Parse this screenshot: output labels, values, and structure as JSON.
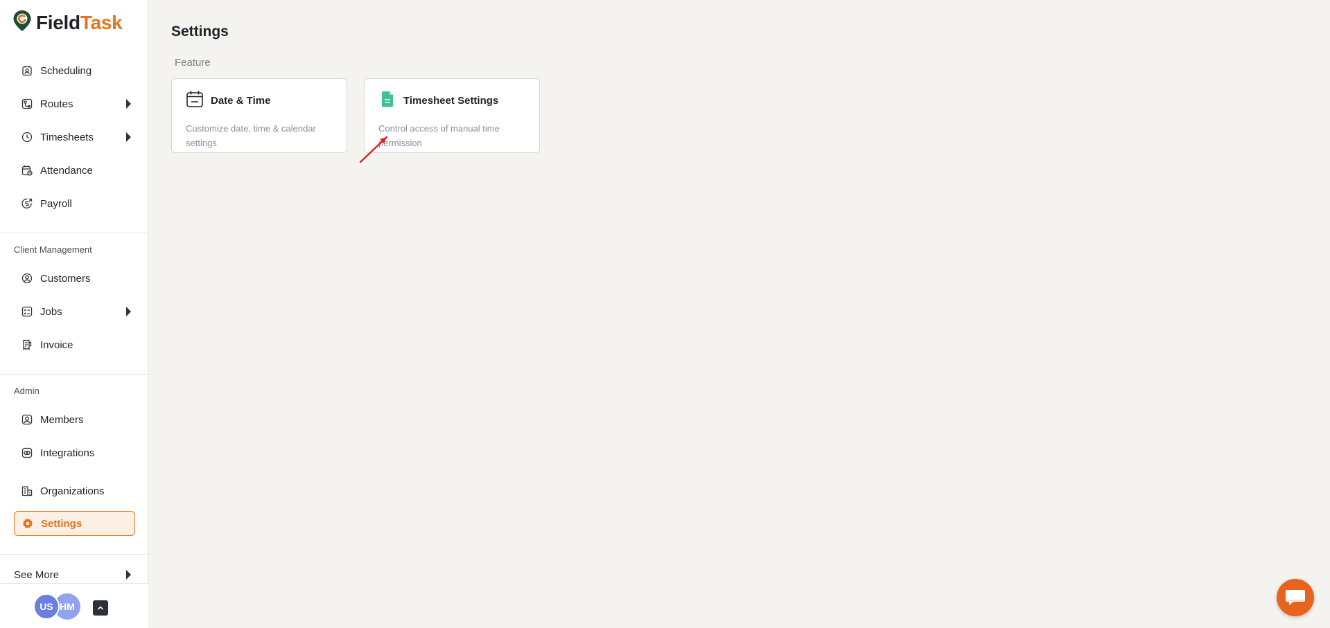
{
  "app": {
    "logo_part1": "Field",
    "logo_part2": "Task",
    "brand_color": "#e8731c"
  },
  "sidebar": {
    "main_items": [
      {
        "label": "Scheduling",
        "icon": "calendar-person-icon"
      },
      {
        "label": "Routes",
        "icon": "route-icon",
        "has_submenu": true
      },
      {
        "label": "Timesheets",
        "icon": "clock-icon",
        "has_submenu": true
      },
      {
        "label": "Attendance",
        "icon": "calendar-check-icon"
      },
      {
        "label": "Payroll",
        "icon": "dollar-icon"
      }
    ],
    "client_section_label": "Client Management",
    "client_items": [
      {
        "label": "Customers",
        "icon": "customer-icon"
      },
      {
        "label": "Jobs",
        "icon": "jobs-icon",
        "has_submenu": true
      },
      {
        "label": "Invoice",
        "icon": "invoice-icon"
      }
    ],
    "admin_section_label": "Admin",
    "admin_items": [
      {
        "label": "Members",
        "icon": "member-icon"
      },
      {
        "label": "Integrations",
        "icon": "integrations-icon"
      },
      {
        "label": "Organizations",
        "icon": "organizations-icon"
      },
      {
        "label": "Settings",
        "icon": "gear-icon",
        "active": true
      }
    ],
    "see_more_label": "See More",
    "avatars": [
      "US",
      "HM"
    ]
  },
  "main": {
    "title": "Settings",
    "section_heading": "Feature",
    "cards": [
      {
        "title": "Date & Time",
        "description": "Customize date, time & calendar settings",
        "icon": "calendar-icon"
      },
      {
        "title": "Timesheet Settings",
        "description": "Control access of manual time permission",
        "icon": "timesheet-doc-icon"
      }
    ]
  }
}
